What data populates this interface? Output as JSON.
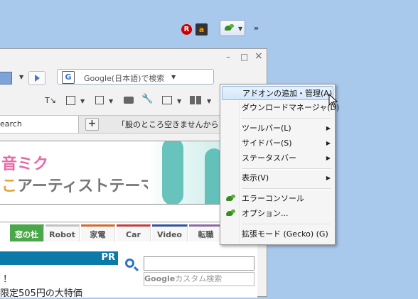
{
  "window": {
    "controls": {
      "minimize": "–",
      "maximize": "□",
      "close": "×"
    }
  },
  "toolbar": {
    "search_placeholder": "Google(日本語)で検索",
    "search_engine_icon": "G",
    "rakuten_badge": "R",
    "amazon_badge": "a",
    "overflow_label": "»"
  },
  "tabs": [
    {
      "label": "earch"
    },
    {
      "label": "「股のところ空きませんから！」"
    }
  ],
  "newtab_label": "+",
  "page": {
    "banner_line1": "音ミク",
    "banner_line2_prefix": "こ",
    "banner_line2": "アーティストテーマ登場",
    "nav": [
      {
        "label": "窓の杜",
        "color": "#4aa84a",
        "active": true
      },
      {
        "label": "Robot",
        "color": "#c2c2c2"
      },
      {
        "label": "家電",
        "color": "#d46a2a"
      },
      {
        "label": "Car",
        "color": "#c43c3c"
      },
      {
        "label": "Video",
        "color": "#3050a0"
      },
      {
        "label": "転職",
        "color": "#8a6aa0"
      }
    ],
    "pr_label": "PR",
    "google_custom_search": "カスタム検索",
    "google_logo": "Google",
    "exclaim": "！",
    "bottom_text": "限定505円の大特価"
  },
  "menu": {
    "items": [
      {
        "label": "アドオンの追加・管理(A)",
        "highlighted": true
      },
      {
        "label": "ダウンロードマネージャ(D)"
      },
      {
        "label": "ツールバー(L)",
        "submenu": true
      },
      {
        "label": "サイドバー(S)",
        "submenu": true
      },
      {
        "label": "ステータスバー",
        "submenu": true
      },
      {
        "label": "表示(V)",
        "submenu": true
      },
      {
        "label": "エラーコンソール",
        "icon": "lizard-icon"
      },
      {
        "label": "オプション...",
        "icon": "lizard-icon"
      },
      {
        "label": "拡張モード (Gecko) (G)"
      }
    ]
  },
  "colors": {
    "desktop": "#a8c8ec",
    "menu_highlight": "#d3e6fb",
    "pr_bar": "#0a7aa8"
  }
}
